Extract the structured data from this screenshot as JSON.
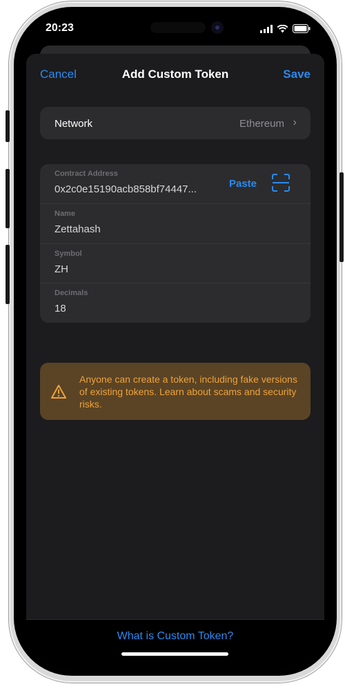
{
  "status_bar": {
    "time": "20:23"
  },
  "nav": {
    "cancel_label": "Cancel",
    "title": "Add Custom Token",
    "save_label": "Save"
  },
  "network": {
    "label": "Network",
    "value": "Ethereum"
  },
  "form": {
    "contract_address": {
      "label": "Contract Address",
      "value": "0x2c0e15190acb858bf74447...",
      "paste_label": "Paste"
    },
    "name": {
      "label": "Name",
      "value": "Zettahash"
    },
    "symbol": {
      "label": "Symbol",
      "value": "ZH"
    },
    "decimals": {
      "label": "Decimals",
      "value": "18"
    }
  },
  "warning": {
    "text": "Anyone can create a token, including fake versions of existing tokens. Learn about scams and security risks."
  },
  "footer": {
    "link_label": "What is Custom Token?"
  },
  "colors": {
    "accent": "#2a8af0",
    "warning_bg": "#5a4425",
    "warning_text": "#f0a23a",
    "sheet_bg": "#1c1c1e",
    "card_bg": "#2c2c2e"
  },
  "icons": {
    "warning": "warning-triangle-icon",
    "scan": "qr-scan-icon",
    "chevron": "chevron-right-icon"
  }
}
